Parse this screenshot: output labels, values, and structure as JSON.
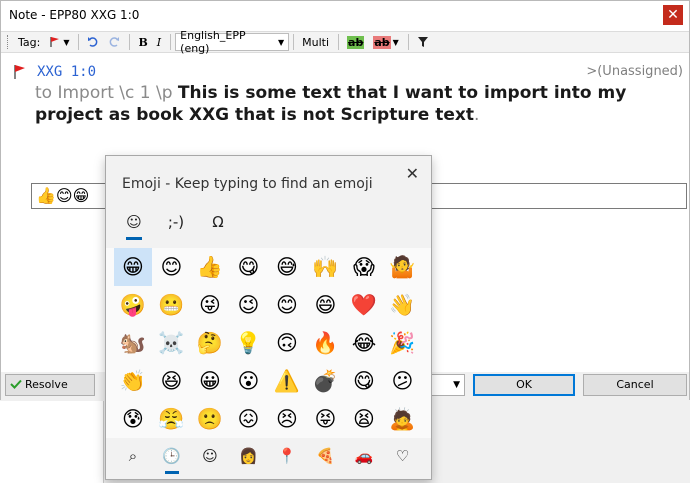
{
  "window": {
    "title": "Note - EPP80 XXG 1:0",
    "close_label": "✕"
  },
  "toolbar": {
    "tag_label": "Tag:",
    "bold_label": "B",
    "italic_label": "I",
    "language_value": "English_EPP (eng)",
    "multi_label": "Multi",
    "ab_green": "ab",
    "ab_red": "ab"
  },
  "note": {
    "reference": "XXG 1:0",
    "assignment": ">(Unassigned)",
    "markers": "to Import \\c 1 \\p ",
    "text": "This is some text that I want to import into my project as book XXG that is not Scripture text",
    "trailing": ".",
    "edit_emojis": "👍😊😁"
  },
  "buttons": {
    "resolve": "Resolve",
    "ok": "OK",
    "cancel": "Cancel"
  },
  "emoji_panel": {
    "title": "Emoji - Keep typing to find an emoji",
    "close": "✕",
    "tabs": [
      "☺",
      ";-)",
      "Ω"
    ],
    "rows": [
      [
        "😁",
        "😊",
        "👍",
        "😋",
        "😅",
        "🙌",
        "😱",
        "🤷"
      ],
      [
        "🤪",
        "😬",
        "😜",
        "😉",
        "😊",
        "😄",
        "❤️",
        "👋"
      ],
      [
        "🐿️",
        "☠️",
        "🤔",
        "💡",
        "🙃",
        "🔥",
        "😂",
        "🎉"
      ],
      [
        "👏",
        "😆",
        "😀",
        "😮",
        "⚠️",
        "💣",
        "😋",
        "😕"
      ],
      [
        "😰",
        "😤",
        "🙁",
        "😖",
        "😣",
        "😝",
        "😫",
        "🙇"
      ]
    ],
    "nav": [
      "⌕",
      "🕒",
      "☺",
      "👩",
      "📍",
      "🍕",
      "🚗",
      "♡"
    ]
  }
}
